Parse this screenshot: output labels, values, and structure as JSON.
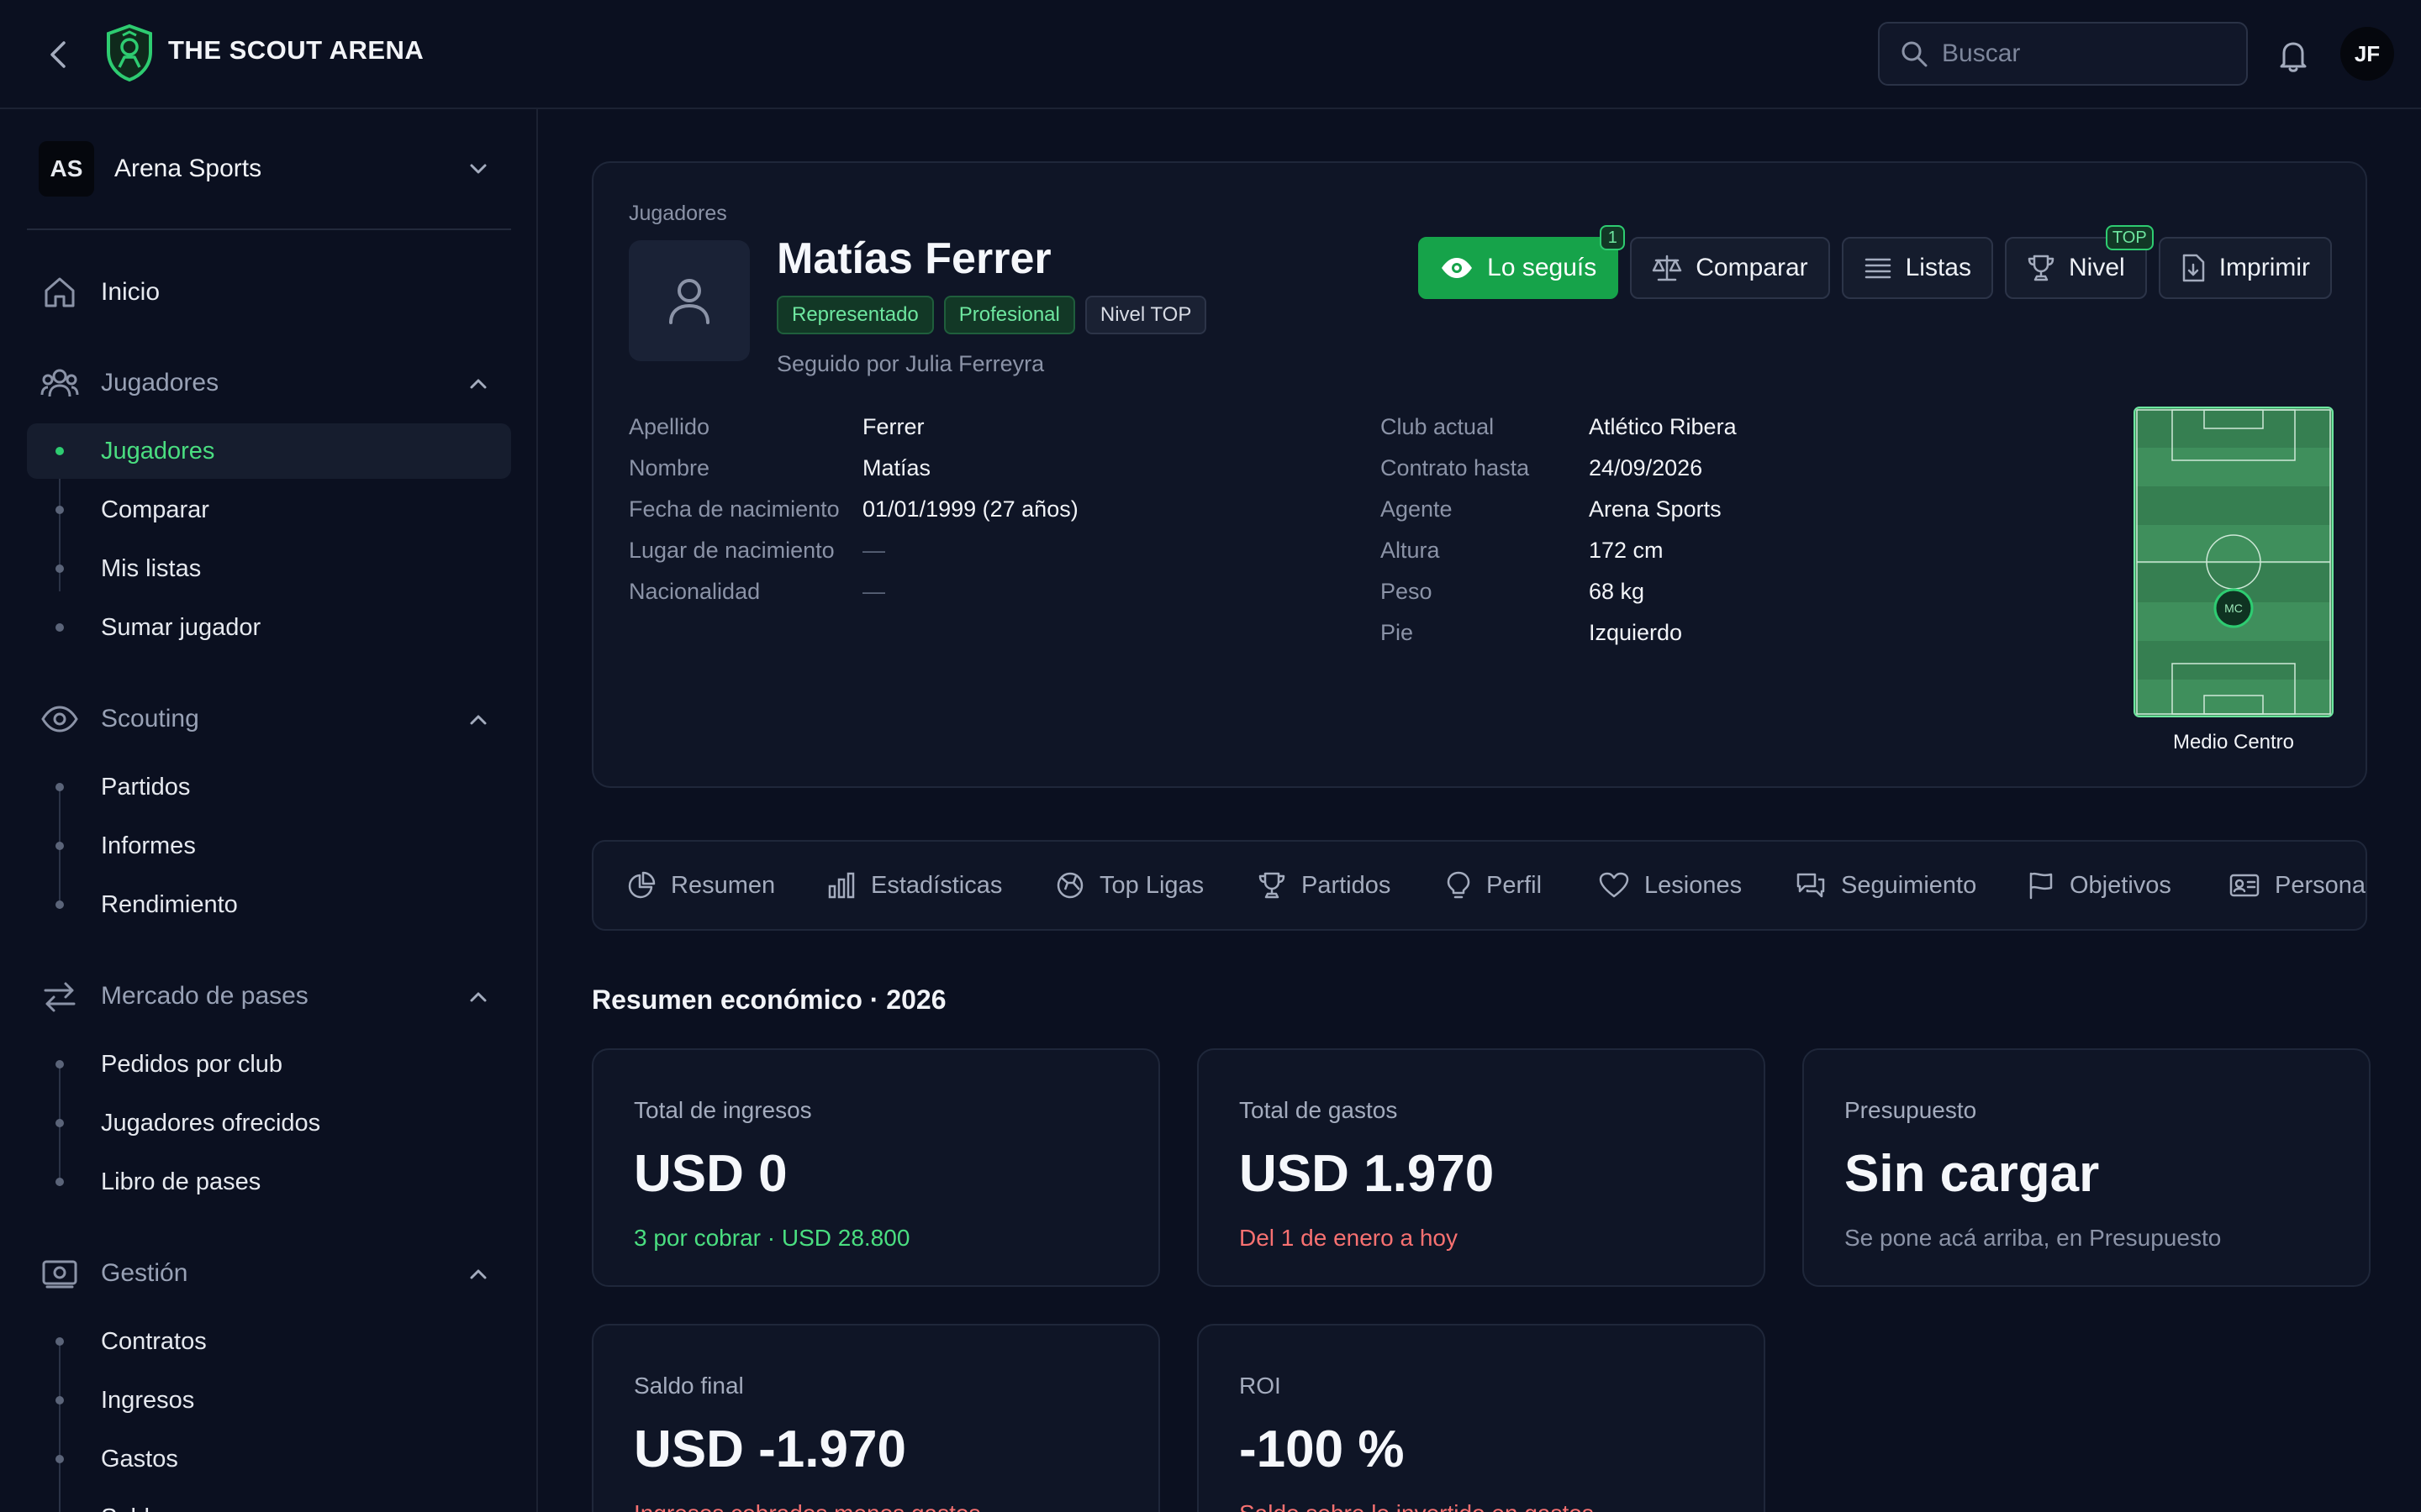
{
  "app": {
    "brand": "THE SCOUT ARENA",
    "search_placeholder": "Buscar",
    "user_initials": "JF"
  },
  "sidebar": {
    "org": {
      "initials": "AS",
      "name": "Arena Sports"
    },
    "inicio": "Inicio",
    "sections": [
      {
        "label": "Jugadores",
        "items": [
          "Jugadores",
          "Comparar",
          "Mis listas",
          "Sumar jugador"
        ]
      },
      {
        "label": "Scouting",
        "items": [
          "Partidos",
          "Informes",
          "Rendimiento"
        ]
      },
      {
        "label": "Mercado de pases",
        "items": [
          "Pedidos por club",
          "Jugadores ofrecidos",
          "Libro de pases"
        ]
      },
      {
        "label": "Gestión",
        "items": [
          "Contratos",
          "Ingresos",
          "Gastos",
          "Saldos"
        ]
      }
    ]
  },
  "player": {
    "breadcrumb": "Jugadores",
    "name": "Matías Ferrer",
    "chips": [
      "Representado",
      "Profesional",
      "Nivel TOP"
    ],
    "followed_by": "Seguido por Julia Ferreyra",
    "actions": {
      "follow": "Lo seguís",
      "follow_badge": "1",
      "compare": "Comparar",
      "lists": "Listas",
      "level": "Nivel",
      "level_badge": "TOP",
      "print": "Imprimir"
    },
    "info_left": [
      {
        "k": "Apellido",
        "v": "Ferrer"
      },
      {
        "k": "Nombre",
        "v": "Matías"
      },
      {
        "k": "Fecha de nacimiento",
        "v": "01/01/1999 (27 años)"
      },
      {
        "k": "Lugar de nacimiento",
        "v": "—"
      },
      {
        "k": "Nacionalidad",
        "v": "—"
      }
    ],
    "info_right": [
      {
        "k": "Club actual",
        "v": "Atlético Ribera"
      },
      {
        "k": "Contrato hasta",
        "v": "24/09/2026"
      },
      {
        "k": "Agente",
        "v": "Arena Sports"
      },
      {
        "k": "Altura",
        "v": "172 cm"
      },
      {
        "k": "Peso",
        "v": "68 kg"
      },
      {
        "k": "Pie",
        "v": "Izquierdo"
      }
    ],
    "position_code": "MC",
    "position_label": "Medio Centro"
  },
  "tabs": [
    "Resumen",
    "Estadísticas",
    "Top Ligas",
    "Partidos",
    "Perfil",
    "Lesiones",
    "Seguimiento",
    "Objetivos",
    "Personal"
  ],
  "summary": {
    "title": "Resumen económico · 2026",
    "cards": [
      {
        "title": "Total de ingresos",
        "value": "USD 0",
        "sub": "3 por cobrar · USD 28.800"
      },
      {
        "title": "Total de gastos",
        "value": "USD 1.970",
        "sub": "Del 1 de enero a hoy"
      },
      {
        "title": "Presupuesto",
        "value": "Sin cargar",
        "sub": "Se pone acá arriba, en Presupuesto"
      },
      {
        "title": "Saldo final",
        "value": "USD -1.970",
        "sub": "Ingresos cobrados menos gastos"
      },
      {
        "title": "ROI",
        "value": "-100 %",
        "sub": "Saldo sobre lo invertido en gastos"
      }
    ]
  },
  "colors": {
    "accent": "#16a34a",
    "accent_text": "#4ade80",
    "negative": "#f87171",
    "background": "#0b1020",
    "card": "#0f1526"
  }
}
